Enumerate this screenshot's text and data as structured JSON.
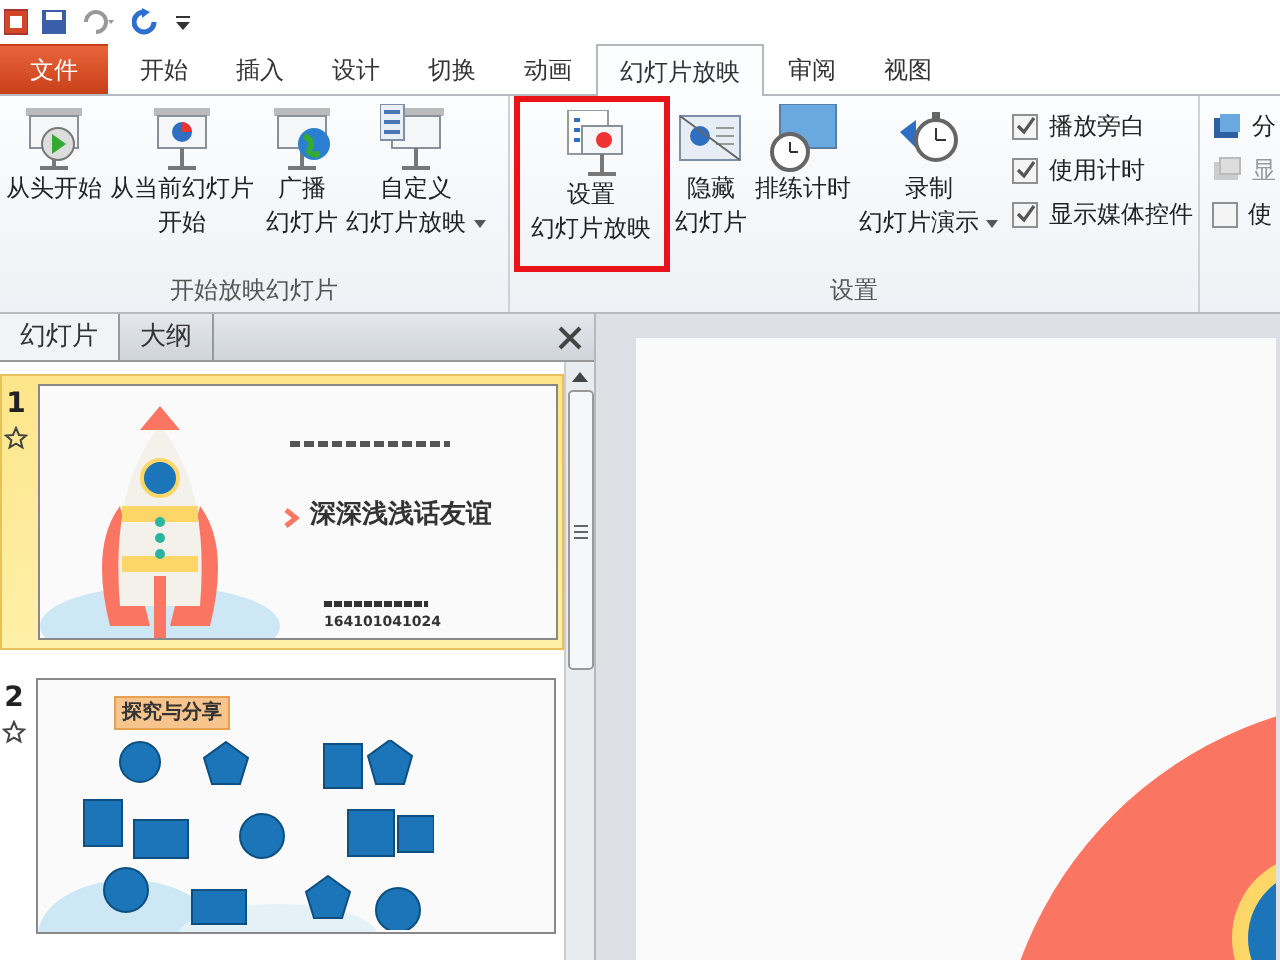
{
  "tabs": [
    {
      "label": "文件",
      "kind": "file",
      "selected": false
    },
    {
      "label": "开始",
      "kind": "tab",
      "selected": false
    },
    {
      "label": "插入",
      "kind": "tab",
      "selected": false
    },
    {
      "label": "设计",
      "kind": "tab",
      "selected": false
    },
    {
      "label": "切换",
      "kind": "tab",
      "selected": false
    },
    {
      "label": "动画",
      "kind": "tab",
      "selected": false
    },
    {
      "label": "幻灯片放映",
      "kind": "tab",
      "selected": true
    },
    {
      "label": "审阅",
      "kind": "tab",
      "selected": false
    },
    {
      "label": "视图",
      "kind": "tab",
      "selected": false
    }
  ],
  "ribbon": {
    "groups": [
      {
        "label": "开始放映幻灯片",
        "items": [
          {
            "kind": "large-button",
            "lines": [
              "从头开始"
            ],
            "dropdown": false,
            "highlighted": false
          },
          {
            "kind": "large-button",
            "lines": [
              "从当前幻灯片",
              "开始"
            ],
            "dropdown": false,
            "highlighted": false
          },
          {
            "kind": "separator"
          },
          {
            "kind": "large-button",
            "lines": [
              "广播",
              "幻灯片"
            ],
            "dropdown": false,
            "highlighted": false
          },
          {
            "kind": "large-button",
            "lines": [
              "自定义",
              "幻灯片放映"
            ],
            "dropdown": true,
            "highlighted": false
          }
        ]
      },
      {
        "label": "设置",
        "items": [
          {
            "kind": "large-button",
            "lines": [
              "设置",
              "幻灯片放映"
            ],
            "dropdown": false,
            "highlighted": true
          },
          {
            "kind": "large-button",
            "lines": [
              "隐藏",
              "幻灯片"
            ],
            "dropdown": false,
            "highlighted": false
          },
          {
            "kind": "large-button",
            "lines": [
              "排练计时"
            ],
            "dropdown": false,
            "highlighted": false
          },
          {
            "kind": "large-button",
            "lines": [
              "录制",
              "幻灯片演示"
            ],
            "dropdown": true,
            "highlighted": false
          },
          {
            "kind": "checkbox-stack",
            "checkboxes": [
              {
                "label": "播放旁白",
                "checked": true
              },
              {
                "label": "使用计时",
                "checked": true
              },
              {
                "label": "显示媒体控件",
                "checked": true
              }
            ]
          }
        ]
      },
      {
        "items": [
          {
            "kind": "small-stack",
            "rows": [
              {
                "kind": "small-button",
                "label": "分",
                "disabled": false
              },
              {
                "kind": "small-button",
                "label": "显",
                "disabled": true
              },
              {
                "kind": "checkbox",
                "label": "使",
                "checked": false
              }
            ]
          }
        ]
      }
    ]
  },
  "pane": {
    "tabs": [
      {
        "label": "幻灯片",
        "selected": true
      },
      {
        "label": "大纲",
        "selected": false
      }
    ],
    "slides": [
      {
        "number": "1",
        "selected": true,
        "kind": "title",
        "title": "深深浅浅话友谊",
        "subtitle": "164101041024"
      },
      {
        "number": "2",
        "selected": false,
        "kind": "diagram",
        "title": "探究与分享"
      }
    ]
  }
}
